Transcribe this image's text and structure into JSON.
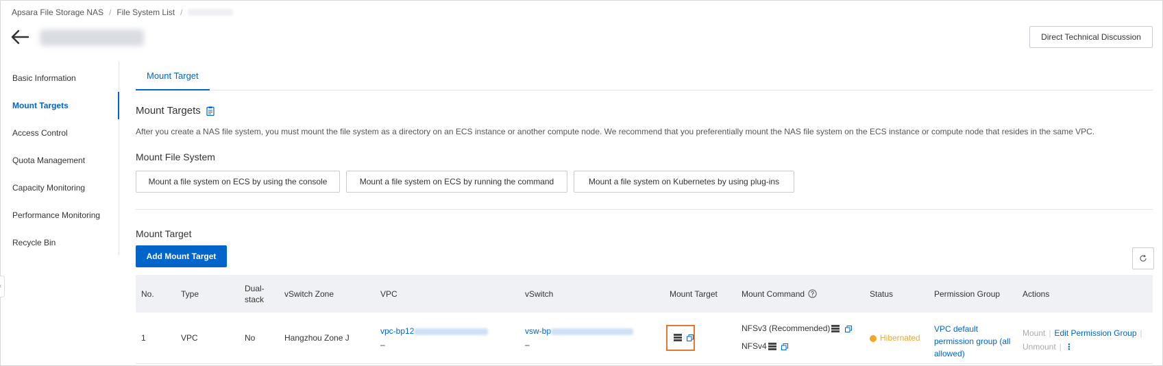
{
  "breadcrumb": {
    "item1": "Apsara File Storage NAS",
    "item2": "File System List",
    "sep": "/"
  },
  "header": {
    "discussion_button": "Direct Technical Discussion"
  },
  "sidebar": {
    "items": [
      {
        "label": "Basic Information"
      },
      {
        "label": "Mount Targets",
        "active": true
      },
      {
        "label": "Access Control"
      },
      {
        "label": "Quota Management"
      },
      {
        "label": "Capacity Monitoring"
      },
      {
        "label": "Performance Monitoring"
      },
      {
        "label": "Recycle Bin"
      }
    ]
  },
  "tabs": [
    {
      "label": "Mount Target",
      "active": true
    }
  ],
  "section": {
    "title": "Mount Targets",
    "description": "After you create a NAS file system, you must mount the file system as a directory on an ECS instance or another compute node. We recommend that you preferentially mount the NAS file system on the ECS instance or compute node that resides in the same VPC.",
    "mount_fs_title": "Mount File System",
    "buttons": [
      "Mount a file system on ECS by using the console",
      "Mount a file system on ECS by running the command",
      "Mount a file system on Kubernetes by using plug-ins"
    ]
  },
  "list": {
    "title": "Mount Target",
    "add_button": "Add Mount Target",
    "columns": [
      "No.",
      "Type",
      "Dual-stack",
      "vSwitch Zone",
      "VPC",
      "vSwitch",
      "Mount Target",
      "Mount Command",
      "Status",
      "Permission Group",
      "Actions"
    ],
    "rows": [
      {
        "no": "1",
        "type": "VPC",
        "dual_stack": "No",
        "zone": "Hangzhou Zone J",
        "vpc_prefix": "vpc-bp12",
        "vpc_sub": "–",
        "vswitch_prefix": "vsw-bp",
        "vswitch_sub": "–",
        "cmd_nfsv3": "NFSv3 (Recommended)",
        "cmd_nfsv4": "NFSv4",
        "status": "Hibernated",
        "permission_group": "VPC default permission group (all allowed)",
        "action_mount": "Mount",
        "action_edit": "Edit Permission Group",
        "action_unmount": "Unmount"
      }
    ]
  },
  "colors": {
    "accent": "#0064c8",
    "status_hibernated": "#f5a623",
    "highlight": "#e8762d"
  }
}
